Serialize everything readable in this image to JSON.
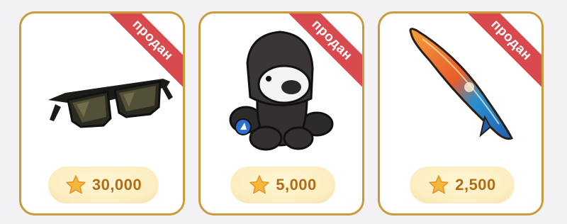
{
  "items": [
    {
      "name": "sunglasses",
      "status": "продан",
      "price": "30,000",
      "icon": "sunglasses-icon"
    },
    {
      "name": "plush",
      "status": "продан",
      "price": "5,000",
      "icon": "hooded-plush-icon"
    },
    {
      "name": "surfboard",
      "status": "продан",
      "price": "2,500",
      "icon": "surfboard-icon"
    }
  ],
  "colors": {
    "card_border": "#c99a3e",
    "ribbon": "#d94a4f",
    "price_text": "#b36c11",
    "price_pill": "#fbedbf",
    "star": "#f5b73b"
  }
}
